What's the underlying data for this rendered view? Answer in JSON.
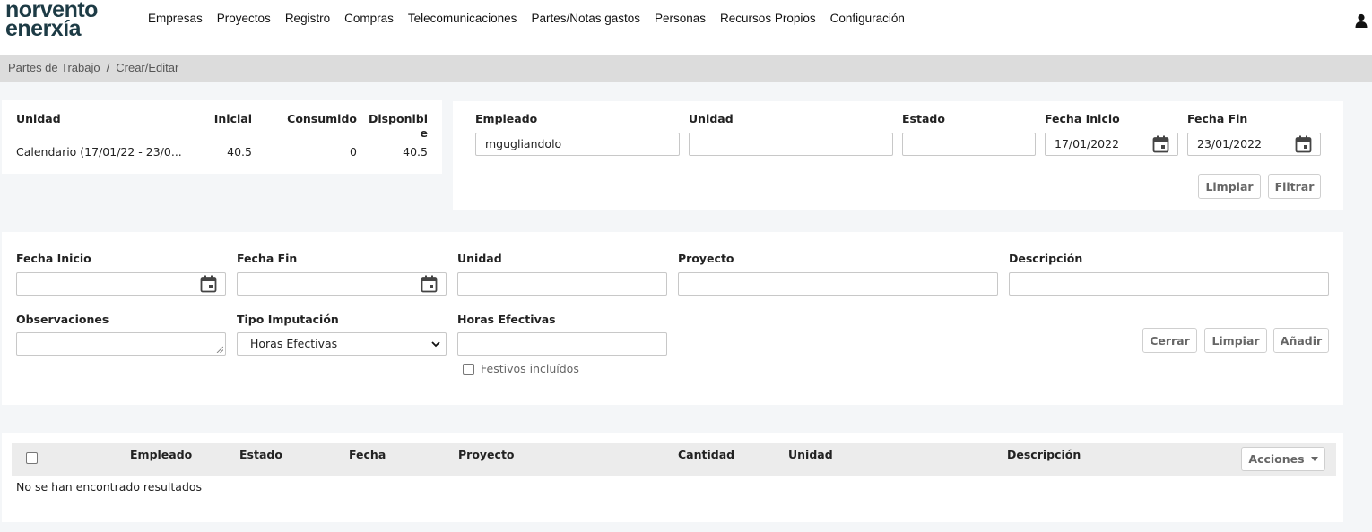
{
  "brand": {
    "line1": "norvento",
    "line2": "enerxía"
  },
  "nav": [
    "Empresas",
    "Proyectos",
    "Registro",
    "Compras",
    "Telecomunicaciones",
    "Partes/Notas gastos",
    "Personas",
    "Recursos Propios",
    "Configuración"
  ],
  "breadcrumb": {
    "parent": "Partes de Trabajo",
    "separator": "/",
    "current": "Crear/Editar"
  },
  "summary": {
    "headers": {
      "unidad": "Unidad",
      "inicial": "Inicial",
      "consumido": "Consumido",
      "disponible_1": "Disponibl",
      "disponible_2": "e"
    },
    "row": {
      "unidad": "Calendario (17/01/22 - 23/0...",
      "inicial": "40.5",
      "consumido": "0",
      "disponible": "40.5"
    }
  },
  "filter": {
    "empleado_label": "Empleado",
    "empleado_value": "mgugliandolo",
    "unidad_label": "Unidad",
    "unidad_value": "",
    "estado_label": "Estado",
    "estado_value": "",
    "fecha_inicio_label": "Fecha Inicio",
    "fecha_inicio_value": "17/01/2022",
    "fecha_fin_label": "Fecha Fin",
    "fecha_fin_value": "23/01/2022",
    "limpiar": "Limpiar",
    "filtrar": "Filtrar"
  },
  "form": {
    "fecha_inicio_label": "Fecha Inicio",
    "fecha_inicio_value": "",
    "fecha_fin_label": "Fecha Fin",
    "fecha_fin_value": "",
    "unidad_label": "Unidad",
    "unidad_value": "",
    "proyecto_label": "Proyecto",
    "proyecto_value": "",
    "descripcion_label": "Descripción",
    "descripcion_value": "",
    "observaciones_label": "Observaciones",
    "observaciones_value": "",
    "tipo_label": "Tipo Imputación",
    "tipo_value": "Horas Efectivas",
    "horas_label": "Horas Efectivas",
    "horas_value": "",
    "festivos_label": "Festivos incluídos",
    "festivos_checked": false,
    "cerrar": "Cerrar",
    "limpiar": "Limpiar",
    "anadir": "Añadir"
  },
  "table": {
    "columns": [
      "Empleado",
      "Estado",
      "Fecha",
      "Proyecto",
      "Cantidad",
      "Unidad",
      "Descripción"
    ],
    "actions": "Acciones",
    "empty": "No se han encontrado resultados"
  },
  "colors": {
    "brand": "#1d3b45",
    "breadcrumb_bg": "#dcdcdc",
    "page_bg": "#f4f6f8",
    "table_head_bg": "#ececec"
  }
}
